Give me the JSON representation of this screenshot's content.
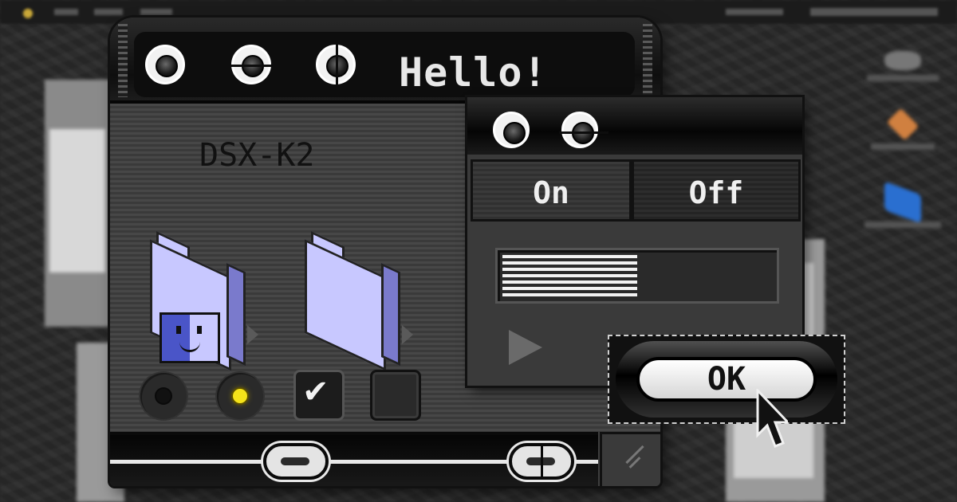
{
  "main_window": {
    "title": "Hello!",
    "device_label": "DSX-K2",
    "folders": [
      {
        "name": "finder-folder-icon"
      },
      {
        "name": "folder-icon"
      }
    ],
    "radio_off": false,
    "radio_on": true,
    "checkbox_checked": true,
    "checkbox_unchecked": false,
    "checkmark": "✔"
  },
  "sub_window": {
    "segments": {
      "on_label": "On",
      "off_label": "Off",
      "selected": "On"
    },
    "progress": 0.5
  },
  "ok_button": {
    "label": "OK"
  },
  "colors": {
    "folder_blue": "#c8c8ff",
    "indicator_yellow": "#f5e31a",
    "chrome_dark": "#0d0d0d"
  }
}
